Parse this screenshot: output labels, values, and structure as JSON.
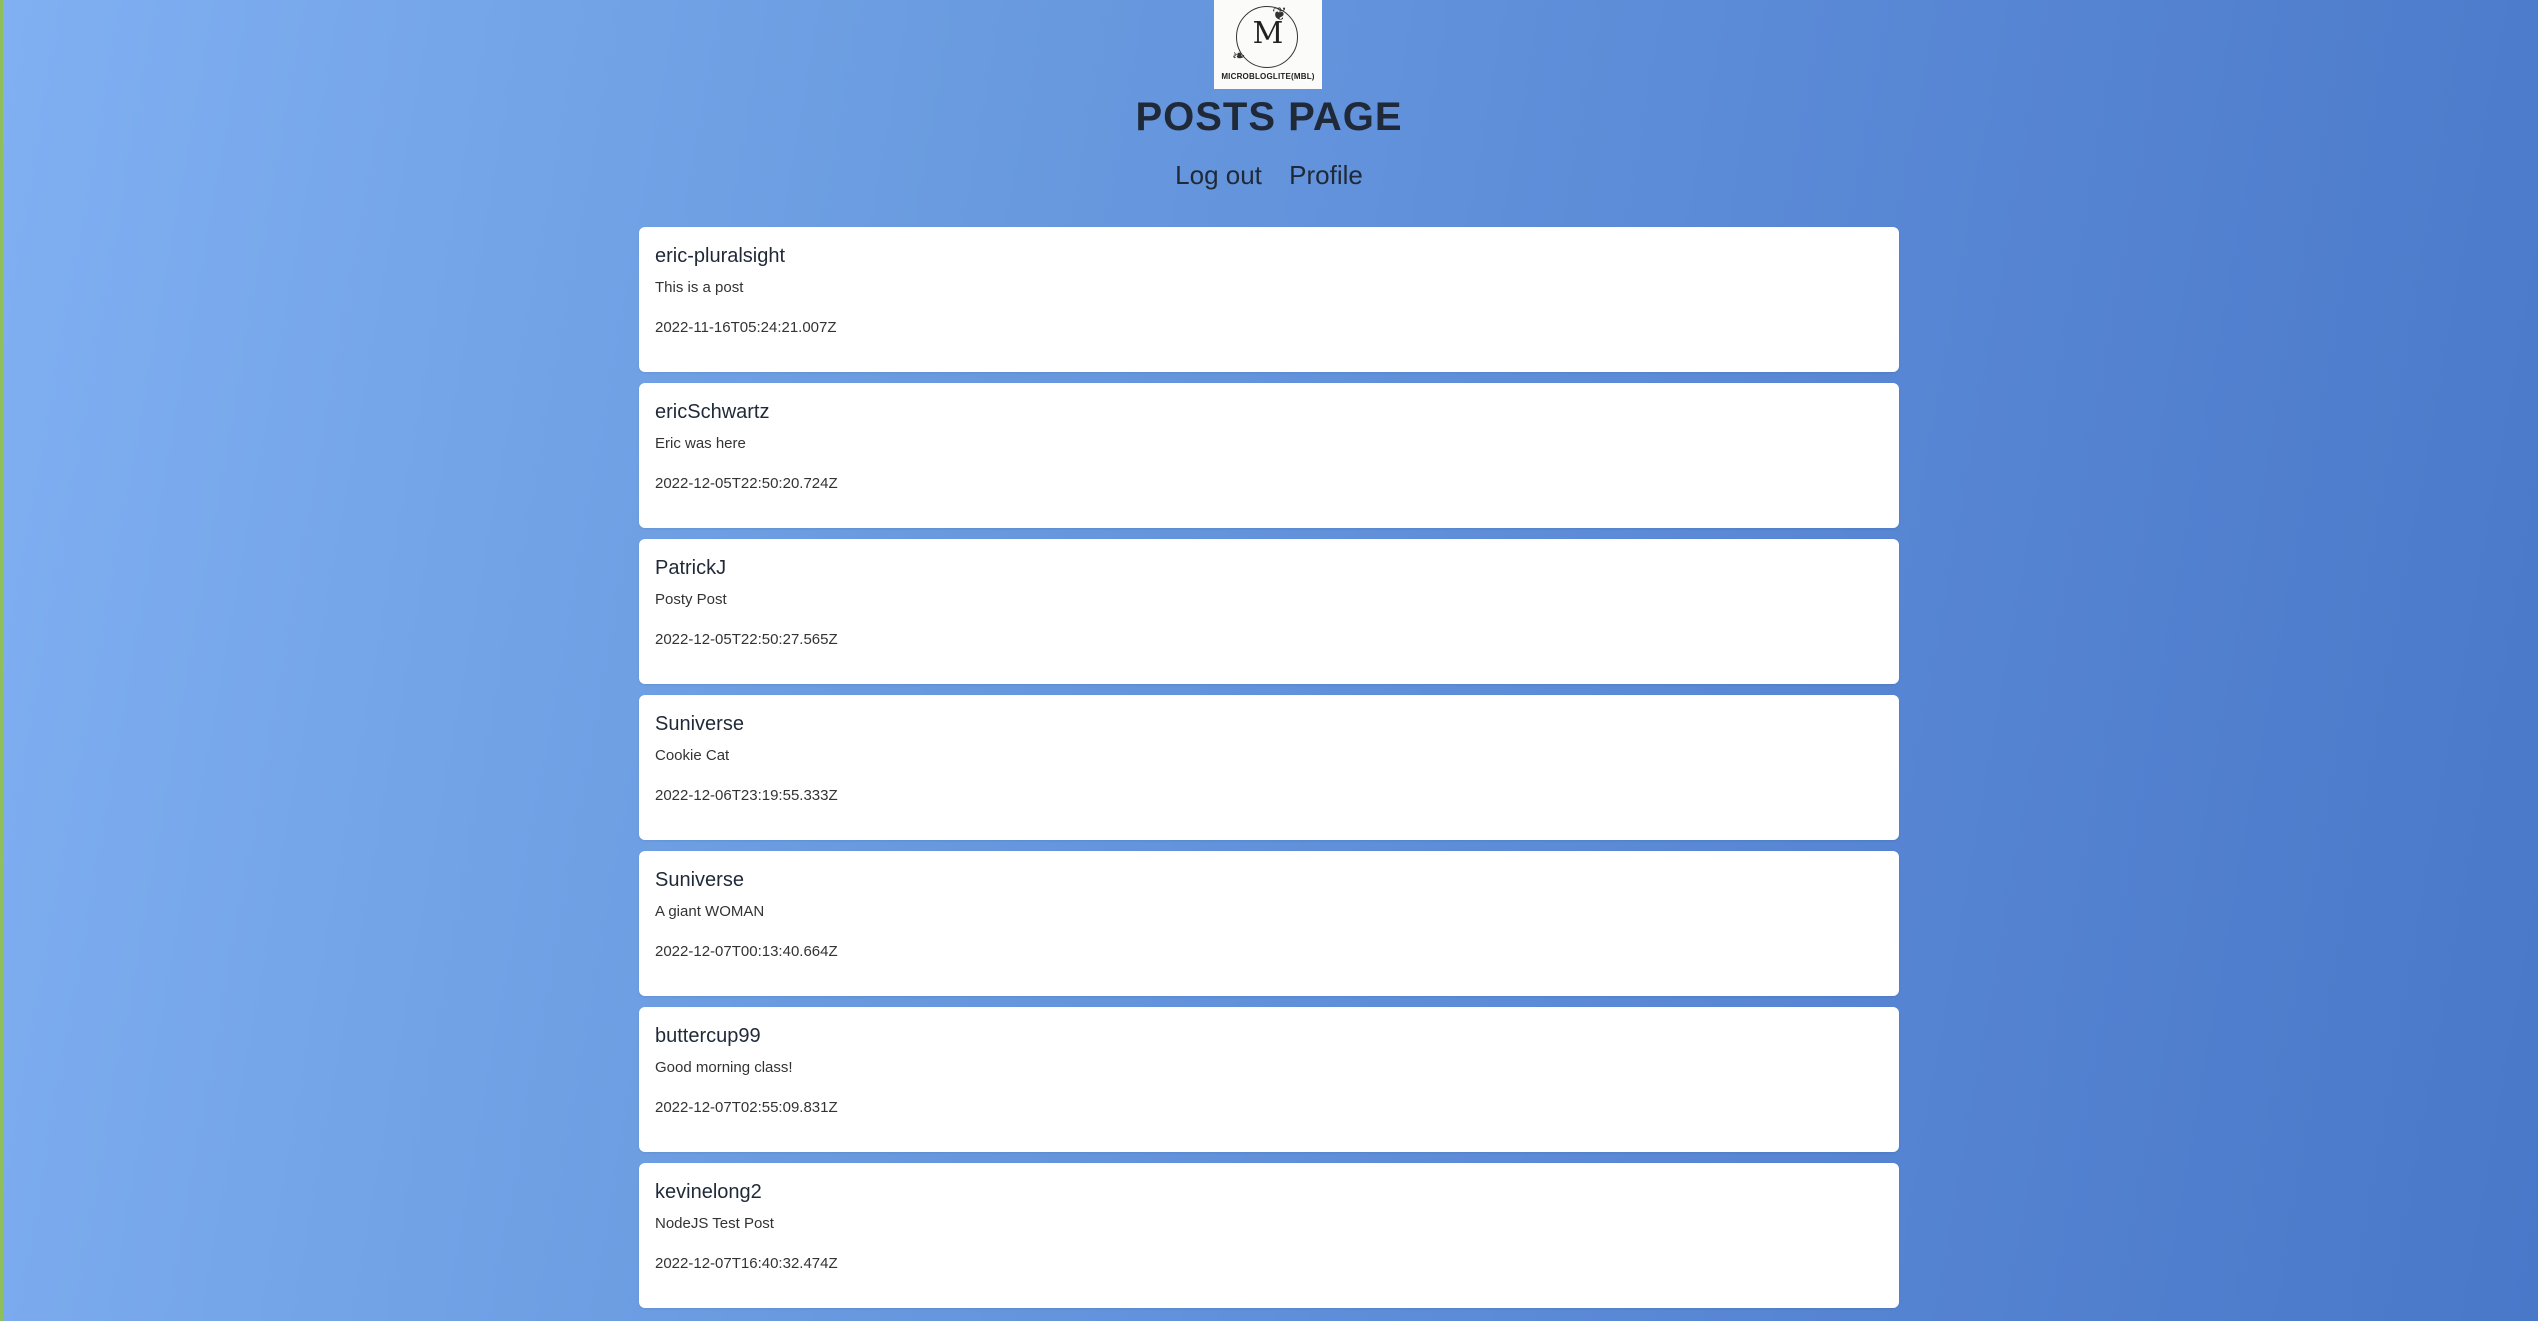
{
  "header": {
    "logo_letter": "M",
    "logo_text": "MICROBLOGLITE(MBL)",
    "title": "POSTS PAGE"
  },
  "nav": {
    "logout_label": "Log out",
    "profile_label": "Profile"
  },
  "posts": [
    {
      "username": "eric-pluralsight",
      "text": "This is a post",
      "created_at": "2022-11-16T05:24:21.007Z"
    },
    {
      "username": "ericSchwartz",
      "text": "Eric was here",
      "created_at": "2022-12-05T22:50:20.724Z"
    },
    {
      "username": "PatrickJ",
      "text": "Posty Post",
      "created_at": "2022-12-05T22:50:27.565Z"
    },
    {
      "username": "Suniverse",
      "text": "Cookie Cat",
      "created_at": "2022-12-06T23:19:55.333Z"
    },
    {
      "username": "Suniverse",
      "text": "A giant WOMAN",
      "created_at": "2022-12-07T00:13:40.664Z"
    },
    {
      "username": "buttercup99",
      "text": "Good morning class!",
      "created_at": "2022-12-07T02:55:09.831Z"
    },
    {
      "username": "kevinelong2",
      "text": "NodeJS Test Post",
      "created_at": "2022-12-07T16:40:32.474Z"
    }
  ]
}
